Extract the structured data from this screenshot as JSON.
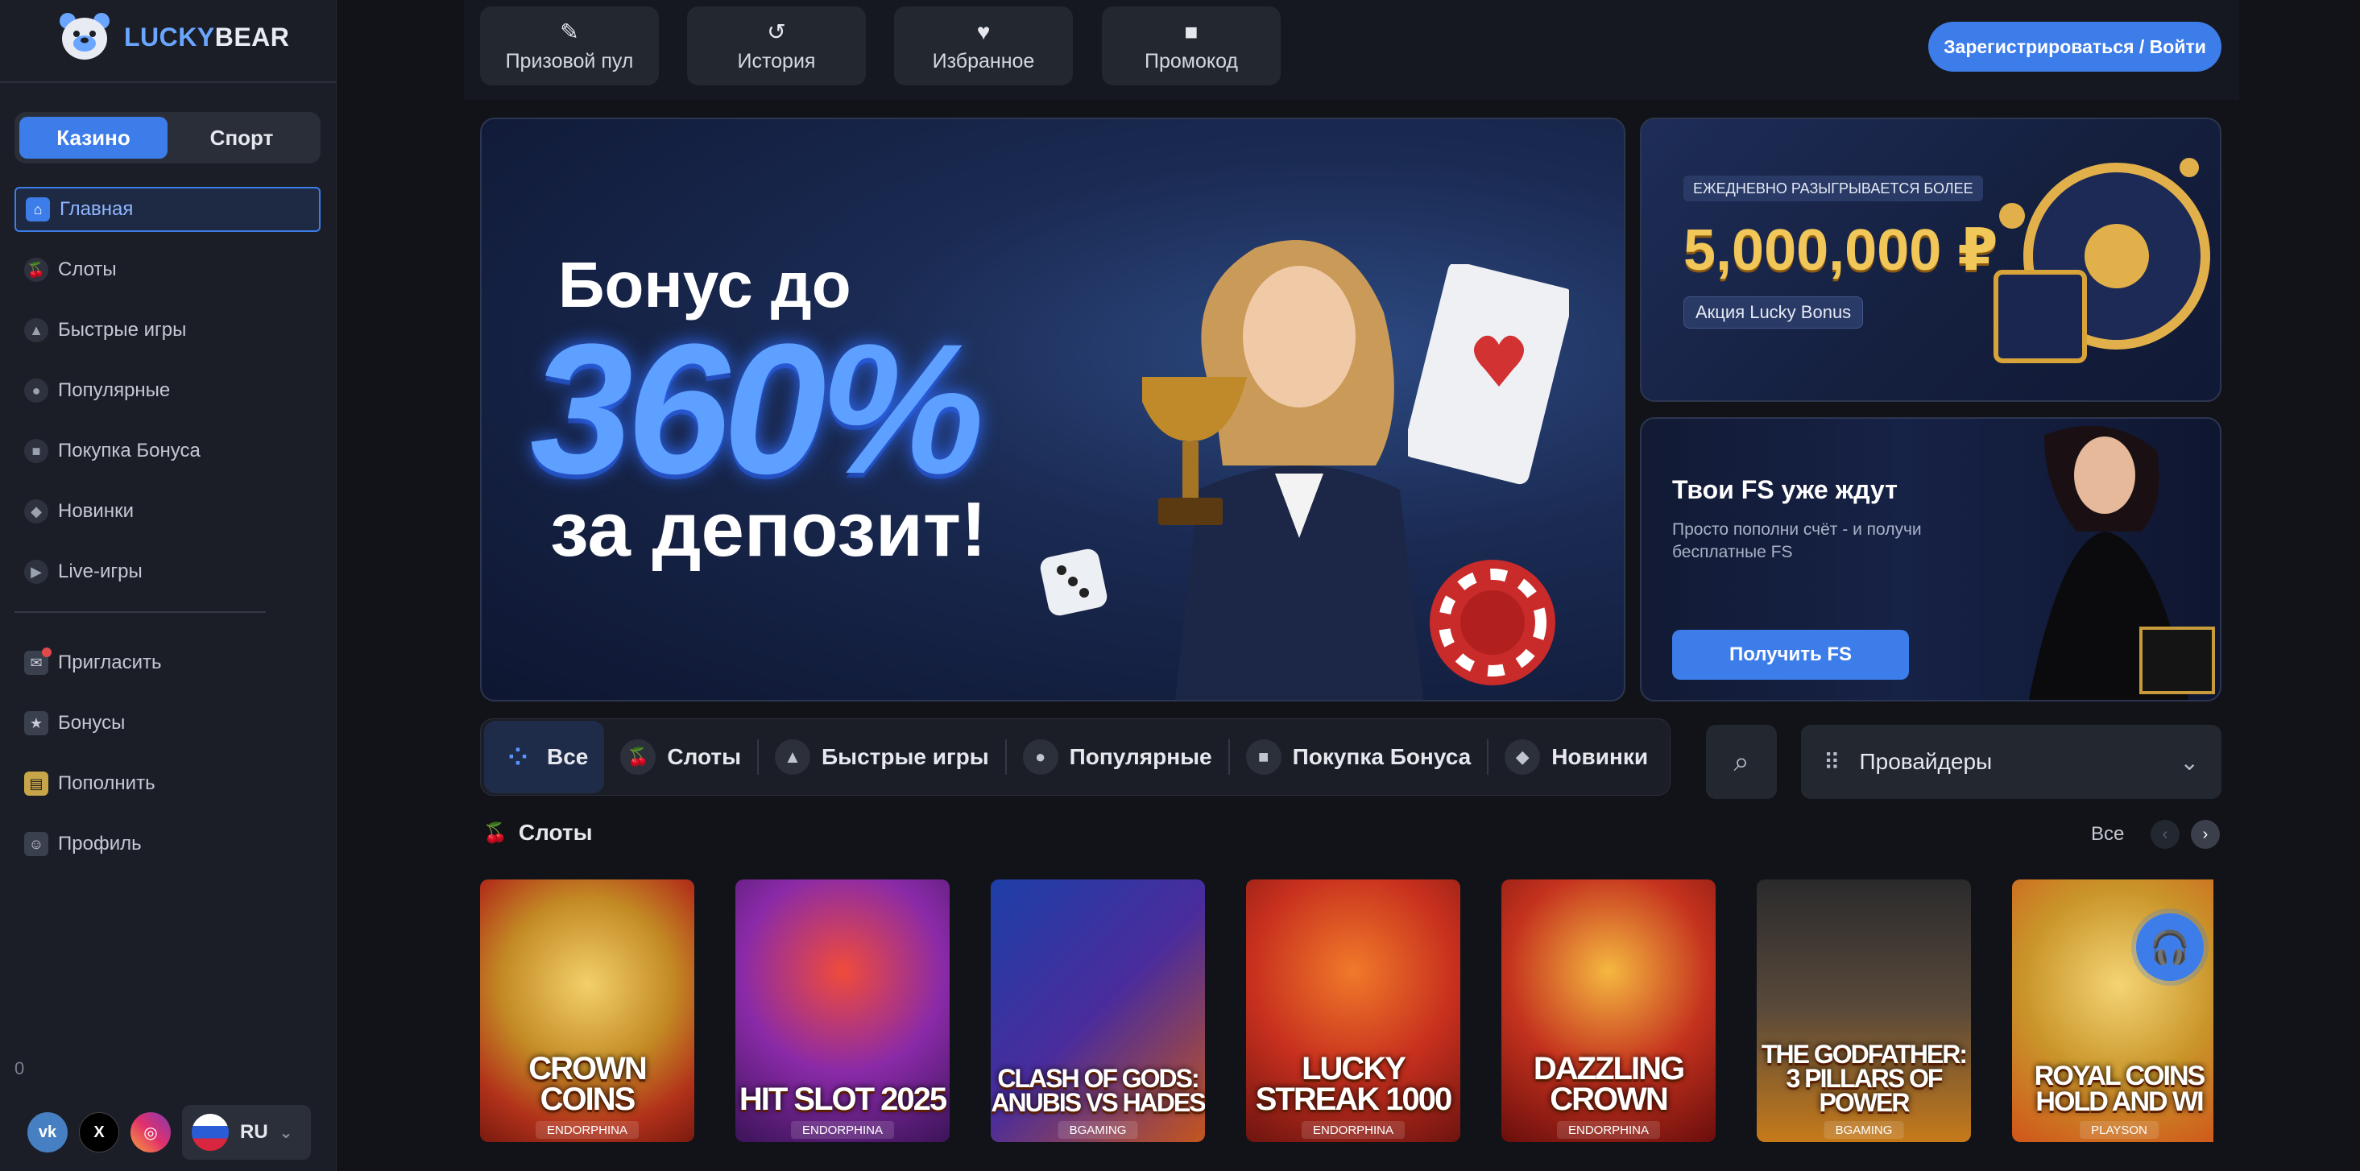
{
  "brand": {
    "lucky": "LUCKY",
    "bear": "BEAR"
  },
  "mode": {
    "casino": "Казино",
    "sport": "Спорт"
  },
  "nav": [
    {
      "label": "Главная",
      "icon": "home-icon"
    },
    {
      "label": "Слоты",
      "icon": "cherry-icon"
    },
    {
      "label": "Быстрые игры",
      "icon": "rocket-icon"
    },
    {
      "label": "Популярные",
      "icon": "flame-icon"
    },
    {
      "label": "Покупка Бонуса",
      "icon": "gift-icon"
    },
    {
      "label": "Новинки",
      "icon": "new-icon"
    },
    {
      "label": "Live-игры",
      "icon": "live-icon"
    }
  ],
  "nav2": [
    {
      "label": "Пригласить",
      "icon": "invite-icon"
    },
    {
      "label": "Бонусы",
      "icon": "bonus-icon"
    },
    {
      "label": "Пополнить",
      "icon": "wallet-icon"
    },
    {
      "label": "Профиль",
      "icon": "user-icon"
    }
  ],
  "counter": "0",
  "lang": "RU",
  "topbar": {
    "prize": "Призовой пул",
    "history": "История",
    "favorites": "Избранное",
    "promo": "Промокод",
    "login": "Зарегистрироваться / Войти"
  },
  "hero": {
    "line1": "Бонус до",
    "line2": "360%",
    "line3": "за депозит!"
  },
  "promo1": {
    "badge": "ЕЖЕДНЕВНО РАЗЫГРЫВАЕТСЯ БОЛЕЕ",
    "amount": "5,000,000 ₽",
    "tag": "Акция Lucky Bonus"
  },
  "promo2": {
    "title": "Твои FS уже ждут",
    "subtitle": "Просто пополни счёт - и получи бесплатные FS",
    "button": "Получить FS"
  },
  "categories": [
    "Все",
    "Слоты",
    "Быстрые игры",
    "Популярные",
    "Покупка Бонуса",
    "Новинки"
  ],
  "providers": "Провайдеры",
  "slots": {
    "title": "Слоты",
    "all": "Все"
  },
  "games": [
    {
      "title": "CROWN COINS",
      "provider": "ENDORPHINA"
    },
    {
      "title": "HIT SLOT 2025",
      "provider": "ENDORPHINA"
    },
    {
      "title": "CLASH OF GODS: ANUBIS VS HADES",
      "provider": "BGAMING"
    },
    {
      "title": "LUCKY STREAK 1000",
      "provider": "ENDORPHINA"
    },
    {
      "title": "DAZZLING CROWN",
      "provider": "ENDORPHINA"
    },
    {
      "title": "THE GODFATHER: 3 PILLARS OF POWER",
      "provider": "BGAMING"
    },
    {
      "title": "ROYAL COINS HOLD AND WI",
      "provider": "PLAYSON"
    }
  ],
  "colors": {
    "accent": "#3d7dea",
    "sidebar": "#1b1e27",
    "background": "#111318",
    "gold": "#f2c75a"
  }
}
